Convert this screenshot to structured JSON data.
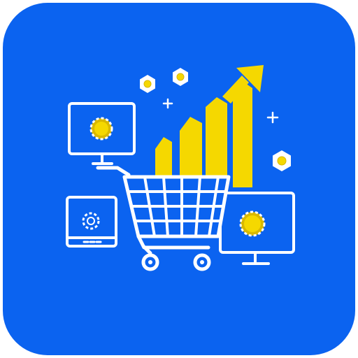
{
  "colors": {
    "background": "#0b63f0",
    "line": "#ffffff",
    "accent": "#f5d800",
    "accent_dark": "#d9b800",
    "page": "#ffffff"
  },
  "icons": [
    "app-tile",
    "desktop-monitor-icon",
    "tablet-icon",
    "shopping-cart-icon",
    "growth-bar-chart-icon",
    "rising-arrow-icon",
    "hexagon-nut-icon",
    "sparkle-plus-icon",
    "laptop-monitor-icon",
    "gear-icon"
  ]
}
